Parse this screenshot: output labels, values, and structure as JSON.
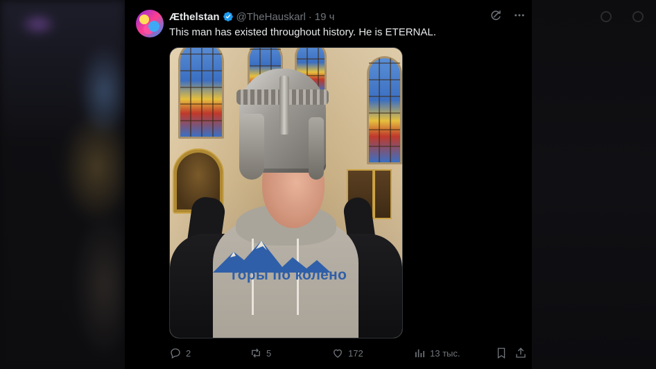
{
  "post": {
    "author_name": "Æthelstan",
    "handle": "@TheHauskarl",
    "separator": "·",
    "time": "19 ч",
    "text": "This man has existed throughout history. He is ETERNAL.",
    "image": {
      "shirt_text": "горы по колено"
    },
    "actions": {
      "replies": "2",
      "reposts": "5",
      "likes": "172",
      "views": "13 тыс."
    }
  },
  "icons": {
    "avatar": "avatar",
    "verified": "verified-badge-icon",
    "grok": "grok-icon",
    "more": "more-icon",
    "reply": "reply-icon",
    "repost": "repost-icon",
    "like": "heart-icon",
    "views": "views-icon",
    "bookmark": "bookmark-icon",
    "share": "share-icon"
  },
  "colors": {
    "background": "#000000",
    "text": "#e7e9ea",
    "muted": "#71767b",
    "verified": "#1d9bf0",
    "shirt_print": "#2f5fa8"
  }
}
